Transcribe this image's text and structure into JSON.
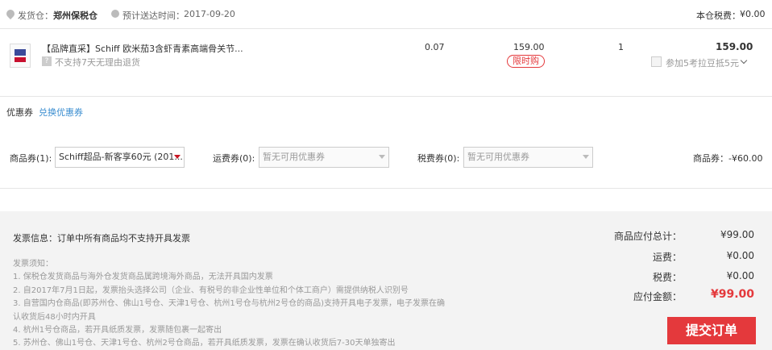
{
  "shipping": {
    "warehouse_label": "发货仓：",
    "warehouse_value": "郑州保税仓",
    "delivery_label": "预计送达时间：",
    "delivery_date": "2017-09-20",
    "tax_label": "本仓税费：",
    "tax_value": "¥0.00"
  },
  "product": {
    "title": "【品牌直采】Schiff 欧米茄3含虾青素高端骨关节...",
    "return_policy": "不支持7天无理由退货",
    "return_icon": "?",
    "weight": "0.07",
    "unit_price": "159.00",
    "promo_badge": "限时购",
    "quantity": "1",
    "subtotal": "159.00",
    "points_text": "参加5考拉豆抵5元"
  },
  "coupon": {
    "title": "优惠券",
    "exchange_link": "兑换优惠券",
    "goods_label": "商品券(1):",
    "goods_selected": "Schiff超品-新客享60元 (201...",
    "shipping_label": "运费券(0):",
    "shipping_placeholder": "暂无可用优惠券",
    "tax_label": "税费券(0):",
    "tax_placeholder": "暂无可用优惠券",
    "discount_text": "商品券：-¥60.00"
  },
  "invoice": {
    "info": "发票信息：订单中所有商品均不支持开具发票",
    "notes_title": "发票须知：",
    "notes": [
      "1. 保税仓发货商品与海外仓发货商品属跨境海外商品，无法开具国内发票",
      "2. 自2017年7月1日起，发票抬头选择公司（企业、有税号的非企业性单位和个体工商户）需提供纳税人识别号",
      "3. 自营国内仓商品(即苏州仓、佛山1号仓、天津1号仓、杭州1号仓与杭州2号仓的商品)支持开具电子发票，电子发票在确",
      "认收货后48小时内开具",
      "4. 杭州1号仓商品，若开具纸质发票，发票随包裹一起寄出",
      "5. 苏州仓、佛山1号仓、天津1号仓、杭州2号仓商品，若开具纸质发票，发票在确认收货后7-30天单独寄出"
    ]
  },
  "summary": {
    "goods_total_label": "商品应付总计：",
    "goods_total_value": "¥99.00",
    "shipping_label": "运费：",
    "shipping_value": "¥0.00",
    "tax_label": "税费：",
    "tax_value": "¥0.00",
    "payable_label": "应付金额：",
    "payable_value": "¥99.00",
    "submit_label": "提交订单"
  },
  "colors": {
    "accent_red": "#e4393c",
    "link_blue": "#3a8dd0"
  }
}
